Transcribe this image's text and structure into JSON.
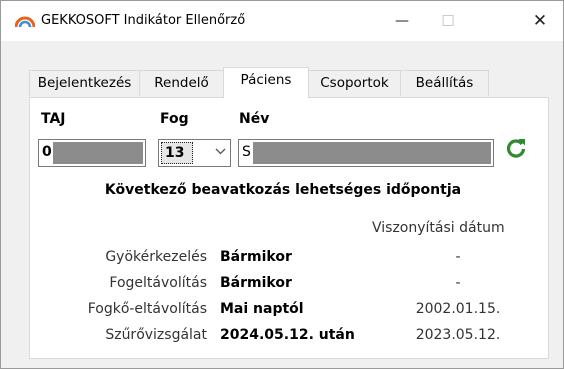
{
  "window": {
    "title": "GEKKOSOFT Indikátor Ellenőrző",
    "minimize_glyph": "—",
    "maximize_glyph": "☐",
    "close_glyph": "✕"
  },
  "tabs": [
    {
      "label": "Bejelentkezés",
      "active": false
    },
    {
      "label": "Rendelő",
      "active": false
    },
    {
      "label": "Páciens",
      "active": true
    },
    {
      "label": "Csoportok",
      "active": false
    },
    {
      "label": "Beállítás",
      "active": false
    }
  ],
  "patient": {
    "taj_label": "TAJ",
    "taj_value": "0",
    "fog_label": "Fog",
    "fog_value": "13",
    "nev_label": "Név",
    "nev_value": "S"
  },
  "section": {
    "heading": "Következő beavatkozás lehetséges időpontja",
    "reference_header": "Viszonyítási dátum",
    "rows": [
      {
        "name": "Gyökérkezelés",
        "when": "Bármikor",
        "reference": "-"
      },
      {
        "name": "Fogeltávolítás",
        "when": "Bármikor",
        "reference": "-"
      },
      {
        "name": "Fogkő-eltávolítás",
        "when": "Mai naptól",
        "reference": "2002.01.15."
      },
      {
        "name": "Szűrővizsgálat",
        "when": "2024.05.12. után",
        "reference": "2023.05.12."
      }
    ]
  },
  "icons": {
    "app": "gekkosoft-logo-icon",
    "refresh": "refresh-icon",
    "dropdown": "chevron-down-icon"
  },
  "colors": {
    "refresh_green": "#2e8b2e",
    "redacted_gray": "#8c8c8c",
    "logo_orange": "#e8621a"
  }
}
